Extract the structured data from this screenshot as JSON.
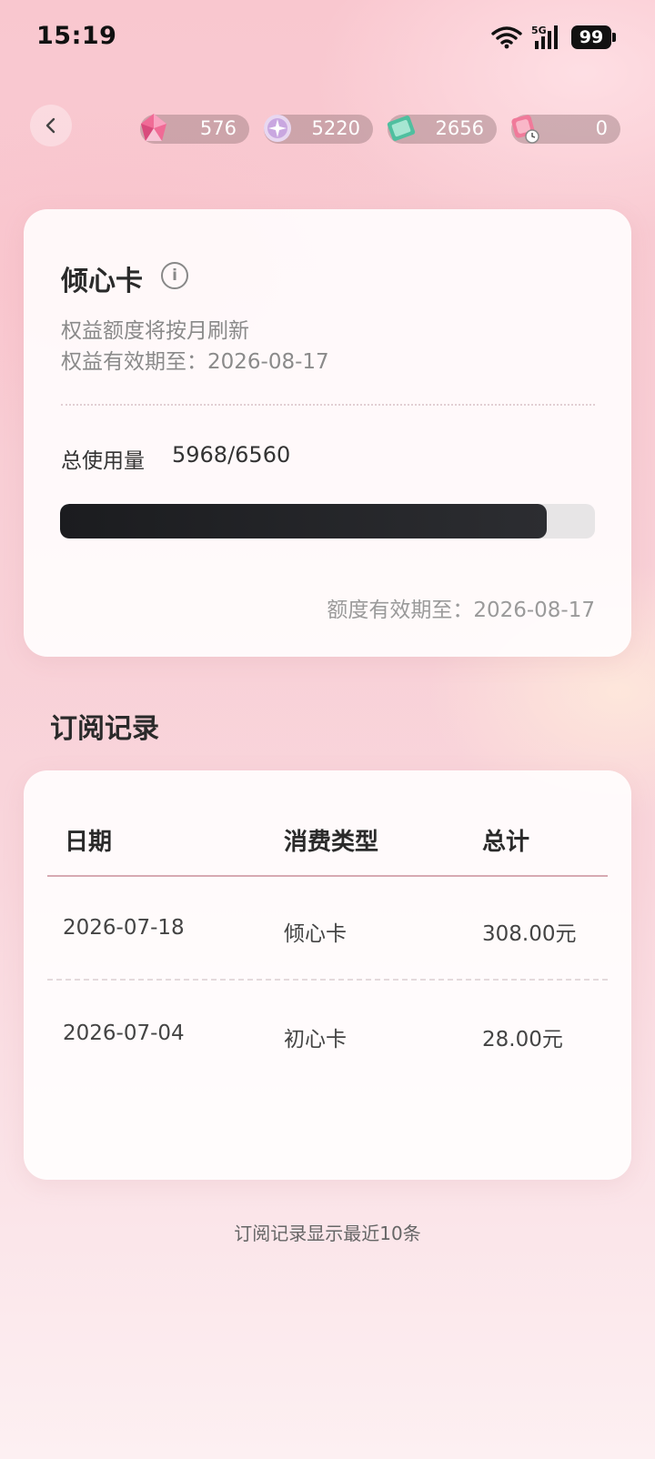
{
  "status_bar": {
    "time": "15:19",
    "network": "5G",
    "battery": "99"
  },
  "currencies": [
    {
      "icon": "pink-crystal-icon",
      "value": "576"
    },
    {
      "icon": "purple-orb-icon",
      "value": "5220"
    },
    {
      "icon": "green-ticket-icon",
      "value": "2656"
    },
    {
      "icon": "timed-crystal-icon",
      "value": "0"
    }
  ],
  "benefit_card": {
    "title": "倾心卡",
    "desc_refresh": "权益额度将按月刷新",
    "desc_valid": "权益有效期至：2026-08-17",
    "usage_label": "总使用量",
    "usage_value": "5968/6560",
    "usage_used": 5968,
    "usage_total": 6560,
    "quota_expiry": "额度有效期至：2026-08-17"
  },
  "records": {
    "title": "订阅记录",
    "columns": [
      "日期",
      "消费类型",
      "总计"
    ],
    "rows": [
      {
        "date": "2026-07-18",
        "type": "倾心卡",
        "total": "308.00元"
      },
      {
        "date": "2026-07-04",
        "type": "初心卡",
        "total": "28.00元"
      }
    ],
    "footer": "订阅记录显示最近10条"
  },
  "colors": {
    "accent_pink": "#f9c7cf",
    "progress": "#1b1c1f",
    "divider": "#d7a9b2"
  }
}
